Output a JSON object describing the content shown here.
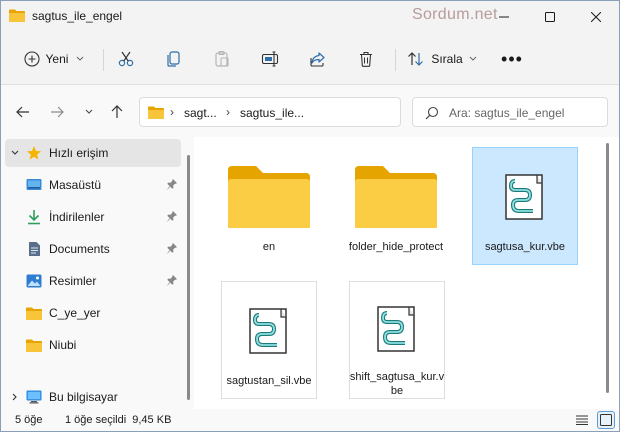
{
  "window": {
    "title": "sagtus_ile_engel",
    "watermark": "Sordum.net",
    "minimize_icon": "minimize-icon",
    "maximize_icon": "maximize-icon",
    "close_icon": "close-icon"
  },
  "toolbar": {
    "new_label": "Yeni",
    "sort_label": "Sırala",
    "more_label": "•••",
    "icons": [
      "plus-circle-icon",
      "cut-icon",
      "copy-icon",
      "paste-icon",
      "rename-icon",
      "share-icon",
      "delete-icon",
      "sort-icon"
    ]
  },
  "nav": {
    "breadcrumb": [
      "sagt...",
      "sagtus_ile..."
    ],
    "search_placeholder": "Ara: sagtus_ile_engel"
  },
  "sidebar": {
    "items": [
      {
        "label": "Hızlı erişim",
        "icon": "star-icon",
        "pinned": false,
        "expanded": true
      },
      {
        "label": "Masaüstü",
        "icon": "desktop-icon",
        "pinned": true
      },
      {
        "label": "İndirilenler",
        "icon": "download-icon",
        "pinned": true
      },
      {
        "label": "Documents",
        "icon": "document-icon",
        "pinned": true
      },
      {
        "label": "Resimler",
        "icon": "pictures-icon",
        "pinned": true
      },
      {
        "label": "C_ye_yer",
        "icon": "folder-icon",
        "pinned": false
      },
      {
        "label": "Niubi",
        "icon": "folder-icon",
        "pinned": false
      },
      {
        "label": "Bu bilgisayar",
        "icon": "computer-icon",
        "pinned": false,
        "expanded": false
      }
    ]
  },
  "files": [
    {
      "name": "en",
      "type": "folder",
      "selected": false
    },
    {
      "name": "folder_hide_protect",
      "type": "folder",
      "selected": false
    },
    {
      "name": "sagtusa_kur.vbe",
      "type": "script",
      "selected": true
    },
    {
      "name": "sagtustan_sil.vbe",
      "type": "script",
      "selected": false
    },
    {
      "name": "shift_sagtusa_kur.vbe",
      "type": "script",
      "selected": false
    }
  ],
  "status": {
    "count": "5 öğe",
    "selection": "1 öğe seçildi  9,45 KB"
  },
  "colors": {
    "selection_bg": "#cce8ff",
    "selection_border": "#99d1ff",
    "folder_yellow": "#f8c53a",
    "accent_blue": "#0067c0"
  }
}
